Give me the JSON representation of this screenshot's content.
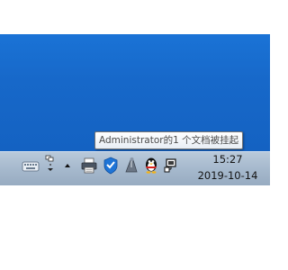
{
  "tooltip": {
    "text": "Administrator的1 个文档被挂起"
  },
  "tray": {
    "icons": [
      "keyboard-ime-icon",
      "language-bar-icon",
      "show-hidden-icons-arrow-icon",
      "printer-icon",
      "security-shield-icon",
      "pen-tool-icon",
      "qq-penguin-icon",
      "network-icon"
    ]
  },
  "clock": {
    "time": "15:27",
    "date": "2019-10-14"
  },
  "colors": {
    "desktop": "#1768c9",
    "taskbar": "#a6b9cd",
    "tooltip_border": "#767676",
    "shield_blue": "#1e74d6",
    "qq_red": "#d8201c"
  }
}
